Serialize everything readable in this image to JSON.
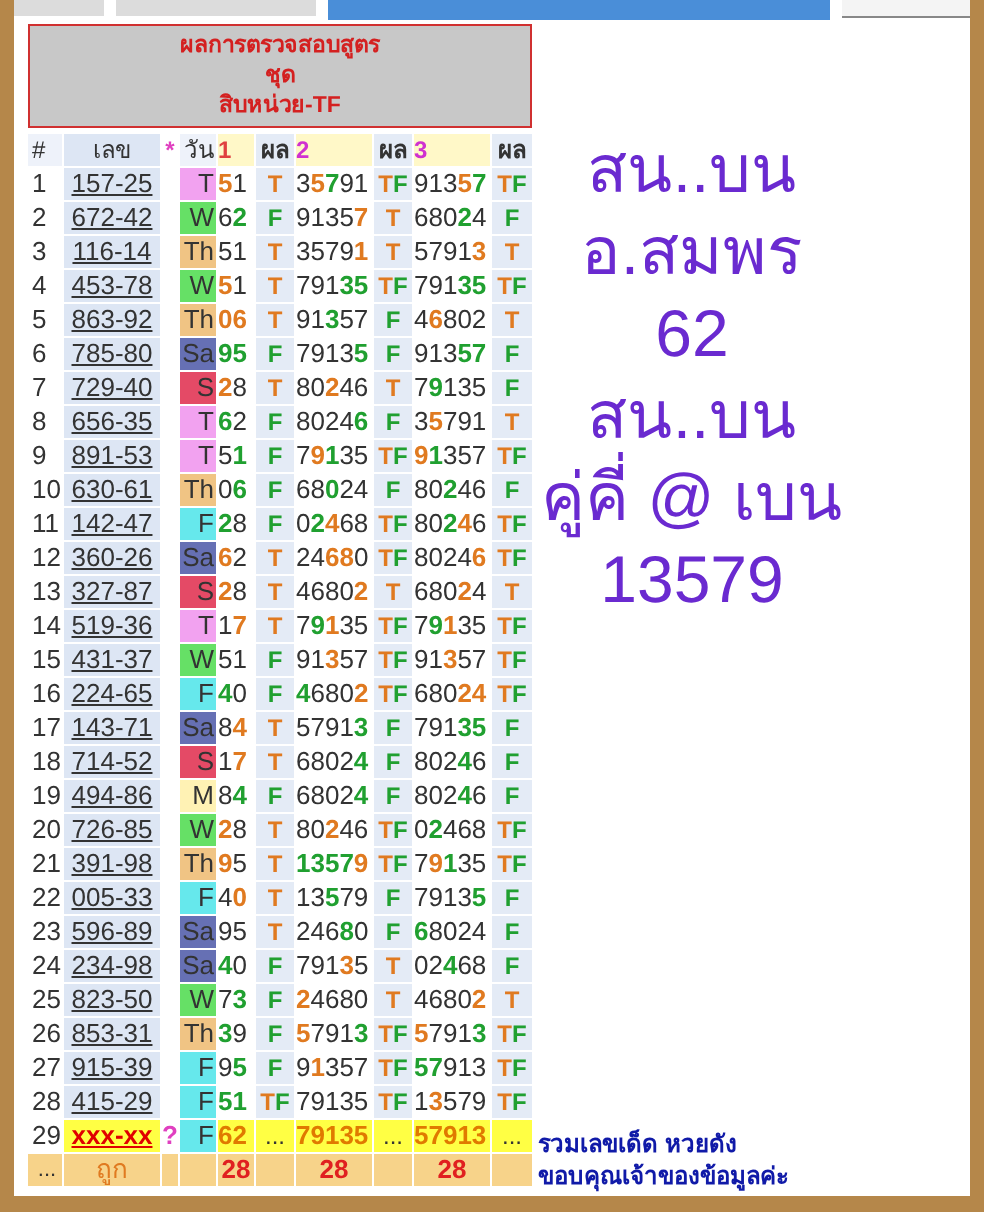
{
  "title_box": {
    "lines": [
      "ผลการตรวจสอบสูตร",
      "ชุด",
      "สิบหน่วย-TF"
    ]
  },
  "columns": [
    {
      "label": "#",
      "kind": "plain"
    },
    {
      "label": "เลข",
      "kind": "plain"
    },
    {
      "label": "*",
      "kind": "star"
    },
    {
      "label": "วัน",
      "kind": "plain"
    },
    {
      "label": "1",
      "kind": "pick1"
    },
    {
      "label": "ผล",
      "kind": "plain"
    },
    {
      "label": "2",
      "kind": "pick"
    },
    {
      "label": "ผล",
      "kind": "plain"
    },
    {
      "label": "3",
      "kind": "pick"
    },
    {
      "label": "ผล",
      "kind": "plain"
    }
  ],
  "rows": [
    {
      "kind": "result",
      "num": "1",
      "code": "157-25",
      "day": {
        "label": "T",
        "color": "#f2a2f0"
      },
      "cells": [
        {
          "parts": [
            {
              "text": "5",
              "color": "#e07a20"
            },
            {
              "text": "1"
            }
          ]
        },
        {
          "parts": [
            {
              "text": "T",
              "color": "#e07a20"
            }
          ]
        },
        {
          "parts": [
            {
              "text": "3"
            },
            {
              "text": "5",
              "color": "#e07a20"
            },
            {
              "text": "7",
              "color": "#20a030"
            },
            {
              "text": "91"
            }
          ]
        },
        {
          "parts": [
            {
              "text": "T",
              "color": "#e07a20"
            },
            {
              "text": "F",
              "color": "#20a030"
            }
          ]
        },
        {
          "parts": [
            {
              "text": "913"
            },
            {
              "text": "5",
              "color": "#e07a20"
            },
            {
              "text": "7",
              "color": "#20a030"
            }
          ]
        },
        {
          "parts": [
            {
              "text": "T",
              "color": "#e07a20"
            },
            {
              "text": "F",
              "color": "#20a030"
            }
          ]
        }
      ]
    },
    {
      "kind": "result",
      "num": "2",
      "code": "672-42",
      "day": {
        "label": "W",
        "color": "#66e066"
      },
      "cells": [
        {
          "parts": [
            {
              "text": "6"
            },
            {
              "text": "2",
              "color": "#20a030"
            }
          ]
        },
        {
          "parts": [
            {
              "text": "F",
              "color": "#20a030"
            }
          ]
        },
        {
          "parts": [
            {
              "text": "9135"
            },
            {
              "text": "7",
              "color": "#e07a20"
            }
          ]
        },
        {
          "parts": [
            {
              "text": "T",
              "color": "#e07a20"
            }
          ]
        },
        {
          "parts": [
            {
              "text": "680"
            },
            {
              "text": "2",
              "color": "#20a030"
            },
            {
              "text": "4"
            }
          ]
        },
        {
          "parts": [
            {
              "text": "F",
              "color": "#20a030"
            }
          ]
        }
      ]
    },
    {
      "kind": "result",
      "num": "3",
      "code": "116-14",
      "day": {
        "label": "Th",
        "color": "#f0c484"
      },
      "cells": [
        {
          "parts": [
            {
              "text": "51"
            }
          ]
        },
        {
          "parts": [
            {
              "text": "T",
              "color": "#e07a20"
            }
          ]
        },
        {
          "parts": [
            {
              "text": "3579"
            },
            {
              "text": "1",
              "color": "#e07a20"
            }
          ]
        },
        {
          "parts": [
            {
              "text": "T",
              "color": "#e07a20"
            }
          ]
        },
        {
          "parts": [
            {
              "text": "5791"
            },
            {
              "text": "3",
              "color": "#e07a20"
            }
          ]
        },
        {
          "parts": [
            {
              "text": "T",
              "color": "#e07a20"
            }
          ]
        }
      ]
    },
    {
      "kind": "result",
      "num": "4",
      "code": "453-78",
      "day": {
        "label": "W",
        "color": "#66e066"
      },
      "cells": [
        {
          "parts": [
            {
              "text": "5",
              "color": "#e07a20"
            },
            {
              "text": "1"
            }
          ]
        },
        {
          "parts": [
            {
              "text": "T",
              "color": "#e07a20"
            }
          ]
        },
        {
          "parts": [
            {
              "text": "791"
            },
            {
              "text": "35",
              "color": "#20a030"
            }
          ]
        },
        {
          "parts": [
            {
              "text": "T",
              "color": "#e07a20"
            },
            {
              "text": "F",
              "color": "#20a030"
            }
          ]
        },
        {
          "parts": [
            {
              "text": "791"
            },
            {
              "text": "35",
              "color": "#20a030"
            }
          ]
        },
        {
          "parts": [
            {
              "text": "T",
              "color": "#e07a20"
            },
            {
              "text": "F",
              "color": "#20a030"
            }
          ]
        }
      ]
    },
    {
      "kind": "result",
      "num": "5",
      "code": "863-92",
      "day": {
        "label": "Th",
        "color": "#f0c484"
      },
      "cells": [
        {
          "parts": [
            {
              "text": "06",
              "color": "#e07a20"
            }
          ]
        },
        {
          "parts": [
            {
              "text": "T",
              "color": "#e07a20"
            }
          ]
        },
        {
          "parts": [
            {
              "text": "91"
            },
            {
              "text": "3",
              "color": "#20a030"
            },
            {
              "text": "57"
            }
          ]
        },
        {
          "parts": [
            {
              "text": "F",
              "color": "#20a030"
            }
          ]
        },
        {
          "parts": [
            {
              "text": "4"
            },
            {
              "text": "6",
              "color": "#e07a20"
            },
            {
              "text": "802"
            }
          ]
        },
        {
          "parts": [
            {
              "text": "T",
              "color": "#e07a20"
            }
          ]
        }
      ]
    },
    {
      "kind": "result",
      "num": "6",
      "code": "785-80",
      "day": {
        "label": "Sa",
        "color": "#6670b4"
      },
      "cells": [
        {
          "parts": [
            {
              "text": "95",
              "color": "#20a030"
            }
          ]
        },
        {
          "parts": [
            {
              "text": "F",
              "color": "#20a030"
            }
          ]
        },
        {
          "parts": [
            {
              "text": "7913"
            },
            {
              "text": "5",
              "color": "#20a030"
            }
          ]
        },
        {
          "parts": [
            {
              "text": "F",
              "color": "#20a030"
            }
          ]
        },
        {
          "parts": [
            {
              "text": "913"
            },
            {
              "text": "57",
              "color": "#20a030"
            }
          ]
        },
        {
          "parts": [
            {
              "text": "F",
              "color": "#20a030"
            }
          ]
        }
      ]
    },
    {
      "kind": "result",
      "num": "7",
      "code": "729-40",
      "day": {
        "label": "S",
        "color": "#e44a66"
      },
      "cells": [
        {
          "parts": [
            {
              "text": "2",
              "color": "#e07a20"
            },
            {
              "text": "8"
            }
          ]
        },
        {
          "parts": [
            {
              "text": "T",
              "color": "#e07a20"
            }
          ]
        },
        {
          "parts": [
            {
              "text": "80"
            },
            {
              "text": "2",
              "color": "#e07a20"
            },
            {
              "text": "46"
            }
          ]
        },
        {
          "parts": [
            {
              "text": "T",
              "color": "#e07a20"
            }
          ]
        },
        {
          "parts": [
            {
              "text": "7"
            },
            {
              "text": "9",
              "color": "#20a030"
            },
            {
              "text": "135"
            }
          ]
        },
        {
          "parts": [
            {
              "text": "F",
              "color": "#20a030"
            }
          ]
        }
      ]
    },
    {
      "kind": "result",
      "num": "8",
      "code": "656-35",
      "day": {
        "label": "T",
        "color": "#f2a2f0"
      },
      "cells": [
        {
          "parts": [
            {
              "text": "6",
              "color": "#20a030"
            },
            {
              "text": "2"
            }
          ]
        },
        {
          "parts": [
            {
              "text": "F",
              "color": "#20a030"
            }
          ]
        },
        {
          "parts": [
            {
              "text": "8024"
            },
            {
              "text": "6",
              "color": "#20a030"
            }
          ]
        },
        {
          "parts": [
            {
              "text": "F",
              "color": "#20a030"
            }
          ]
        },
        {
          "parts": [
            {
              "text": "3"
            },
            {
              "text": "5",
              "color": "#e07a20"
            },
            {
              "text": "791"
            }
          ]
        },
        {
          "parts": [
            {
              "text": "T",
              "color": "#e07a20"
            }
          ]
        }
      ]
    },
    {
      "kind": "result",
      "num": "9",
      "code": "891-53",
      "day": {
        "label": "T",
        "color": "#f2a2f0"
      },
      "cells": [
        {
          "parts": [
            {
              "text": "5"
            },
            {
              "text": "1",
              "color": "#20a030"
            }
          ]
        },
        {
          "parts": [
            {
              "text": "F",
              "color": "#20a030"
            }
          ]
        },
        {
          "parts": [
            {
              "text": "7"
            },
            {
              "text": "9",
              "color": "#e07a20"
            },
            {
              "text": "1",
              "color": "#20a030"
            },
            {
              "text": "35"
            }
          ]
        },
        {
          "parts": [
            {
              "text": "T",
              "color": "#e07a20"
            },
            {
              "text": "F",
              "color": "#20a030"
            }
          ]
        },
        {
          "parts": [
            {
              "text": "9",
              "color": "#e07a20"
            },
            {
              "text": "1",
              "color": "#20a030"
            },
            {
              "text": "357"
            }
          ]
        },
        {
          "parts": [
            {
              "text": "T",
              "color": "#e07a20"
            },
            {
              "text": "F",
              "color": "#20a030"
            }
          ]
        }
      ]
    },
    {
      "kind": "result",
      "num": "10",
      "code": "630-61",
      "day": {
        "label": "Th",
        "color": "#f0c484"
      },
      "cells": [
        {
          "parts": [
            {
              "text": "0"
            },
            {
              "text": "6",
              "color": "#20a030"
            }
          ]
        },
        {
          "parts": [
            {
              "text": "F",
              "color": "#20a030"
            }
          ]
        },
        {
          "parts": [
            {
              "text": "68"
            },
            {
              "text": "0",
              "color": "#20a030"
            },
            {
              "text": "24"
            }
          ]
        },
        {
          "parts": [
            {
              "text": "F",
              "color": "#20a030"
            }
          ]
        },
        {
          "parts": [
            {
              "text": "80"
            },
            {
              "text": "2",
              "color": "#20a030"
            },
            {
              "text": "46"
            }
          ]
        },
        {
          "parts": [
            {
              "text": "F",
              "color": "#20a030"
            }
          ]
        }
      ]
    },
    {
      "kind": "result",
      "num": "11",
      "code": "142-47",
      "day": {
        "label": "F",
        "color": "#66e8ec"
      },
      "cells": [
        {
          "parts": [
            {
              "text": "2",
              "color": "#20a030"
            },
            {
              "text": "8"
            }
          ]
        },
        {
          "parts": [
            {
              "text": "F",
              "color": "#20a030"
            }
          ]
        },
        {
          "parts": [
            {
              "text": "0"
            },
            {
              "text": "2",
              "color": "#20a030"
            },
            {
              "text": "4",
              "color": "#e07a20"
            },
            {
              "text": "68"
            }
          ]
        },
        {
          "parts": [
            {
              "text": "T",
              "color": "#e07a20"
            },
            {
              "text": "F",
              "color": "#20a030"
            }
          ]
        },
        {
          "parts": [
            {
              "text": "80"
            },
            {
              "text": "2",
              "color": "#20a030"
            },
            {
              "text": "4",
              "color": "#e07a20"
            },
            {
              "text": "6"
            }
          ]
        },
        {
          "parts": [
            {
              "text": "T",
              "color": "#e07a20"
            },
            {
              "text": "F",
              "color": "#20a030"
            }
          ]
        }
      ]
    },
    {
      "kind": "result",
      "num": "12",
      "code": "360-26",
      "day": {
        "label": "Sa",
        "color": "#6670b4"
      },
      "cells": [
        {
          "parts": [
            {
              "text": "6",
              "color": "#e07a20"
            },
            {
              "text": "2"
            }
          ]
        },
        {
          "parts": [
            {
              "text": "T",
              "color": "#e07a20"
            }
          ]
        },
        {
          "parts": [
            {
              "text": "24"
            },
            {
              "text": "68",
              "color": "#e07a20"
            },
            {
              "text": "0"
            }
          ]
        },
        {
          "parts": [
            {
              "text": "T",
              "color": "#e07a20"
            },
            {
              "text": "F",
              "color": "#20a030"
            }
          ]
        },
        {
          "parts": [
            {
              "text": "8024"
            },
            {
              "text": "6",
              "color": "#e07a20"
            }
          ]
        },
        {
          "parts": [
            {
              "text": "T",
              "color": "#e07a20"
            },
            {
              "text": "F",
              "color": "#20a030"
            }
          ]
        }
      ]
    },
    {
      "kind": "result",
      "num": "13",
      "code": "327-87",
      "day": {
        "label": "S",
        "color": "#e44a66"
      },
      "cells": [
        {
          "parts": [
            {
              "text": "2",
              "color": "#e07a20"
            },
            {
              "text": "8"
            }
          ]
        },
        {
          "parts": [
            {
              "text": "T",
              "color": "#e07a20"
            }
          ]
        },
        {
          "parts": [
            {
              "text": "4680"
            },
            {
              "text": "2",
              "color": "#e07a20"
            }
          ]
        },
        {
          "parts": [
            {
              "text": "T",
              "color": "#e07a20"
            }
          ]
        },
        {
          "parts": [
            {
              "text": "680"
            },
            {
              "text": "2",
              "color": "#e07a20"
            },
            {
              "text": "4"
            }
          ]
        },
        {
          "parts": [
            {
              "text": "T",
              "color": "#e07a20"
            }
          ]
        }
      ]
    },
    {
      "kind": "result",
      "num": "14",
      "code": "519-36",
      "day": {
        "label": "T",
        "color": "#f2a2f0"
      },
      "cells": [
        {
          "parts": [
            {
              "text": "1"
            },
            {
              "text": "7",
              "color": "#e07a20"
            }
          ]
        },
        {
          "parts": [
            {
              "text": "T",
              "color": "#e07a20"
            }
          ]
        },
        {
          "parts": [
            {
              "text": "7"
            },
            {
              "text": "9",
              "color": "#20a030"
            },
            {
              "text": "1",
              "color": "#e07a20"
            },
            {
              "text": "35"
            }
          ]
        },
        {
          "parts": [
            {
              "text": "T",
              "color": "#e07a20"
            },
            {
              "text": "F",
              "color": "#20a030"
            }
          ]
        },
        {
          "parts": [
            {
              "text": "7"
            },
            {
              "text": "9",
              "color": "#20a030"
            },
            {
              "text": "1",
              "color": "#e07a20"
            },
            {
              "text": "35"
            }
          ]
        },
        {
          "parts": [
            {
              "text": "T",
              "color": "#e07a20"
            },
            {
              "text": "F",
              "color": "#20a030"
            }
          ]
        }
      ]
    },
    {
      "kind": "result",
      "num": "15",
      "code": "431-37",
      "day": {
        "label": "W",
        "color": "#66e066"
      },
      "cells": [
        {
          "parts": [
            {
              "text": "51"
            }
          ]
        },
        {
          "parts": [
            {
              "text": "F",
              "color": "#20a030"
            }
          ]
        },
        {
          "parts": [
            {
              "text": "91"
            },
            {
              "text": "3",
              "color": "#e07a20"
            },
            {
              "text": "57"
            }
          ]
        },
        {
          "parts": [
            {
              "text": "T",
              "color": "#e07a20"
            },
            {
              "text": "F",
              "color": "#20a030"
            }
          ]
        },
        {
          "parts": [
            {
              "text": "91"
            },
            {
              "text": "3",
              "color": "#e07a20"
            },
            {
              "text": "57"
            }
          ]
        },
        {
          "parts": [
            {
              "text": "T",
              "color": "#e07a20"
            },
            {
              "text": "F",
              "color": "#20a030"
            }
          ]
        }
      ]
    },
    {
      "kind": "result",
      "num": "16",
      "code": "224-65",
      "day": {
        "label": "F",
        "color": "#66e8ec"
      },
      "cells": [
        {
          "parts": [
            {
              "text": "4",
              "color": "#20a030"
            },
            {
              "text": "0"
            }
          ]
        },
        {
          "parts": [
            {
              "text": "F",
              "color": "#20a030"
            }
          ]
        },
        {
          "parts": [
            {
              "text": "4",
              "color": "#20a030"
            },
            {
              "text": "680"
            },
            {
              "text": "2",
              "color": "#e07a20"
            }
          ]
        },
        {
          "parts": [
            {
              "text": "T",
              "color": "#e07a20"
            },
            {
              "text": "F",
              "color": "#20a030"
            }
          ]
        },
        {
          "parts": [
            {
              "text": "680"
            },
            {
              "text": "24",
              "color": "#e07a20"
            }
          ]
        },
        {
          "parts": [
            {
              "text": "T",
              "color": "#e07a20"
            },
            {
              "text": "F",
              "color": "#20a030"
            }
          ]
        }
      ]
    },
    {
      "kind": "result",
      "num": "17",
      "code": "143-71",
      "day": {
        "label": "Sa",
        "color": "#6670b4"
      },
      "cells": [
        {
          "parts": [
            {
              "text": "8"
            },
            {
              "text": "4",
              "color": "#e07a20"
            }
          ]
        },
        {
          "parts": [
            {
              "text": "T",
              "color": "#e07a20"
            }
          ]
        },
        {
          "parts": [
            {
              "text": "5791"
            },
            {
              "text": "3",
              "color": "#20a030"
            }
          ]
        },
        {
          "parts": [
            {
              "text": "F",
              "color": "#20a030"
            }
          ]
        },
        {
          "parts": [
            {
              "text": "791"
            },
            {
              "text": "35",
              "color": "#20a030"
            }
          ]
        },
        {
          "parts": [
            {
              "text": "F",
              "color": "#20a030"
            }
          ]
        }
      ]
    },
    {
      "kind": "result",
      "num": "18",
      "code": "714-52",
      "day": {
        "label": "S",
        "color": "#e44a66"
      },
      "cells": [
        {
          "parts": [
            {
              "text": "1"
            },
            {
              "text": "7",
              "color": "#e07a20"
            }
          ]
        },
        {
          "parts": [
            {
              "text": "T",
              "color": "#e07a20"
            }
          ]
        },
        {
          "parts": [
            {
              "text": "6802"
            },
            {
              "text": "4",
              "color": "#20a030"
            }
          ]
        },
        {
          "parts": [
            {
              "text": "F",
              "color": "#20a030"
            }
          ]
        },
        {
          "parts": [
            {
              "text": "802"
            },
            {
              "text": "4",
              "color": "#20a030"
            },
            {
              "text": "6"
            }
          ]
        },
        {
          "parts": [
            {
              "text": "F",
              "color": "#20a030"
            }
          ]
        }
      ]
    },
    {
      "kind": "result",
      "num": "19",
      "code": "494-86",
      "day": {
        "label": "M",
        "color": "#fff2b4"
      },
      "cells": [
        {
          "parts": [
            {
              "text": "8"
            },
            {
              "text": "4",
              "color": "#20a030"
            }
          ]
        },
        {
          "parts": [
            {
              "text": "F",
              "color": "#20a030"
            }
          ]
        },
        {
          "parts": [
            {
              "text": "6802"
            },
            {
              "text": "4",
              "color": "#20a030"
            }
          ]
        },
        {
          "parts": [
            {
              "text": "F",
              "color": "#20a030"
            }
          ]
        },
        {
          "parts": [
            {
              "text": "802"
            },
            {
              "text": "4",
              "color": "#20a030"
            },
            {
              "text": "6"
            }
          ]
        },
        {
          "parts": [
            {
              "text": "F",
              "color": "#20a030"
            }
          ]
        }
      ]
    },
    {
      "kind": "result",
      "num": "20",
      "code": "726-85",
      "day": {
        "label": "W",
        "color": "#66e066"
      },
      "cells": [
        {
          "parts": [
            {
              "text": "2",
              "color": "#e07a20"
            },
            {
              "text": "8"
            }
          ]
        },
        {
          "parts": [
            {
              "text": "T",
              "color": "#e07a20"
            }
          ]
        },
        {
          "parts": [
            {
              "text": "80"
            },
            {
              "text": "2",
              "color": "#e07a20"
            },
            {
              "text": "46"
            }
          ]
        },
        {
          "parts": [
            {
              "text": "T",
              "color": "#e07a20"
            },
            {
              "text": "F",
              "color": "#20a030"
            }
          ]
        },
        {
          "parts": [
            {
              "text": "0"
            },
            {
              "text": "2",
              "color": "#20a030"
            },
            {
              "text": "468"
            }
          ]
        },
        {
          "parts": [
            {
              "text": "T",
              "color": "#e07a20"
            },
            {
              "text": "F",
              "color": "#20a030"
            }
          ]
        }
      ]
    },
    {
      "kind": "result",
      "num": "21",
      "code": "391-98",
      "day": {
        "label": "Th",
        "color": "#f0c484"
      },
      "cells": [
        {
          "parts": [
            {
              "text": "9",
              "color": "#e07a20"
            },
            {
              "text": "5"
            }
          ]
        },
        {
          "parts": [
            {
              "text": "T",
              "color": "#e07a20"
            }
          ]
        },
        {
          "parts": [
            {
              "text": "1357",
              "color": "#20a030"
            },
            {
              "text": "9",
              "color": "#e07a20"
            }
          ]
        },
        {
          "parts": [
            {
              "text": "T",
              "color": "#e07a20"
            },
            {
              "text": "F",
              "color": "#20a030"
            }
          ]
        },
        {
          "parts": [
            {
              "text": "7"
            },
            {
              "text": "9",
              "color": "#e07a20"
            },
            {
              "text": "1",
              "color": "#20a030"
            },
            {
              "text": "35"
            }
          ]
        },
        {
          "parts": [
            {
              "text": "T",
              "color": "#e07a20"
            },
            {
              "text": "F",
              "color": "#20a030"
            }
          ]
        }
      ]
    },
    {
      "kind": "result",
      "num": "22",
      "code": "005-33",
      "day": {
        "label": "F",
        "color": "#66e8ec"
      },
      "cells": [
        {
          "parts": [
            {
              "text": "4"
            },
            {
              "text": "0",
              "color": "#e07a20"
            }
          ]
        },
        {
          "parts": [
            {
              "text": "T",
              "color": "#e07a20"
            }
          ]
        },
        {
          "parts": [
            {
              "text": "13"
            },
            {
              "text": "5",
              "color": "#20a030"
            },
            {
              "text": "79"
            }
          ]
        },
        {
          "parts": [
            {
              "text": "F",
              "color": "#20a030"
            }
          ]
        },
        {
          "parts": [
            {
              "text": "7913"
            },
            {
              "text": "5",
              "color": "#20a030"
            }
          ]
        },
        {
          "parts": [
            {
              "text": "F",
              "color": "#20a030"
            }
          ]
        }
      ]
    },
    {
      "kind": "result",
      "num": "23",
      "code": "596-89",
      "day": {
        "label": "Sa",
        "color": "#6670b4"
      },
      "cells": [
        {
          "parts": [
            {
              "text": "95"
            }
          ]
        },
        {
          "parts": [
            {
              "text": "T",
              "color": "#e07a20"
            }
          ]
        },
        {
          "parts": [
            {
              "text": "246"
            },
            {
              "text": "8",
              "color": "#20a030"
            },
            {
              "text": "0"
            }
          ]
        },
        {
          "parts": [
            {
              "text": "F",
              "color": "#20a030"
            }
          ]
        },
        {
          "parts": [
            {
              "text": "6",
              "color": "#20a030"
            },
            {
              "text": "8024"
            }
          ]
        },
        {
          "parts": [
            {
              "text": "F",
              "color": "#20a030"
            }
          ]
        }
      ]
    },
    {
      "kind": "result",
      "num": "24",
      "code": "234-98",
      "day": {
        "label": "Sa",
        "color": "#6670b4"
      },
      "cells": [
        {
          "parts": [
            {
              "text": "4",
              "color": "#20a030"
            },
            {
              "text": "0"
            }
          ]
        },
        {
          "parts": [
            {
              "text": "F",
              "color": "#20a030"
            }
          ]
        },
        {
          "parts": [
            {
              "text": "791"
            },
            {
              "text": "3",
              "color": "#e07a20"
            },
            {
              "text": "5"
            }
          ]
        },
        {
          "parts": [
            {
              "text": "T",
              "color": "#e07a20"
            }
          ]
        },
        {
          "parts": [
            {
              "text": "02"
            },
            {
              "text": "4",
              "color": "#20a030"
            },
            {
              "text": "68"
            }
          ]
        },
        {
          "parts": [
            {
              "text": "F",
              "color": "#20a030"
            }
          ]
        }
      ]
    },
    {
      "kind": "result",
      "num": "25",
      "code": "823-50",
      "day": {
        "label": "W",
        "color": "#66e066"
      },
      "cells": [
        {
          "parts": [
            {
              "text": "7"
            },
            {
              "text": "3",
              "color": "#20a030"
            }
          ]
        },
        {
          "parts": [
            {
              "text": "F",
              "color": "#20a030"
            }
          ]
        },
        {
          "parts": [
            {
              "text": "2",
              "color": "#e07a20"
            },
            {
              "text": "4680"
            }
          ]
        },
        {
          "parts": [
            {
              "text": "T",
              "color": "#e07a20"
            }
          ]
        },
        {
          "parts": [
            {
              "text": "4680"
            },
            {
              "text": "2",
              "color": "#e07a20"
            }
          ]
        },
        {
          "parts": [
            {
              "text": "T",
              "color": "#e07a20"
            }
          ]
        }
      ]
    },
    {
      "kind": "result",
      "num": "26",
      "code": "853-31",
      "day": {
        "label": "Th",
        "color": "#f0c484"
      },
      "cells": [
        {
          "parts": [
            {
              "text": "3",
              "color": "#20a030"
            },
            {
              "text": "9"
            }
          ]
        },
        {
          "parts": [
            {
              "text": "F",
              "color": "#20a030"
            }
          ]
        },
        {
          "parts": [
            {
              "text": "5",
              "color": "#e07a20"
            },
            {
              "text": "791"
            },
            {
              "text": "3",
              "color": "#20a030"
            }
          ]
        },
        {
          "parts": [
            {
              "text": "T",
              "color": "#e07a20"
            },
            {
              "text": "F",
              "color": "#20a030"
            }
          ]
        },
        {
          "parts": [
            {
              "text": "5",
              "color": "#e07a20"
            },
            {
              "text": "791"
            },
            {
              "text": "3",
              "color": "#20a030"
            }
          ]
        },
        {
          "parts": [
            {
              "text": "T",
              "color": "#e07a20"
            },
            {
              "text": "F",
              "color": "#20a030"
            }
          ]
        }
      ]
    },
    {
      "kind": "result",
      "num": "27",
      "code": "915-39",
      "day": {
        "label": "F",
        "color": "#66e8ec"
      },
      "cells": [
        {
          "parts": [
            {
              "text": "9"
            },
            {
              "text": "5",
              "color": "#20a030"
            }
          ]
        },
        {
          "parts": [
            {
              "text": "F",
              "color": "#20a030"
            }
          ]
        },
        {
          "parts": [
            {
              "text": "9"
            },
            {
              "text": "1",
              "color": "#e07a20"
            },
            {
              "text": "357"
            }
          ]
        },
        {
          "parts": [
            {
              "text": "T",
              "color": "#e07a20"
            },
            {
              "text": "F",
              "color": "#20a030"
            }
          ]
        },
        {
          "parts": [
            {
              "text": "57",
              "color": "#20a030"
            },
            {
              "text": "913"
            }
          ]
        },
        {
          "parts": [
            {
              "text": "T",
              "color": "#e07a20"
            },
            {
              "text": "F",
              "color": "#20a030"
            }
          ]
        }
      ]
    },
    {
      "kind": "result",
      "num": "28",
      "code": "415-29",
      "day": {
        "label": "F",
        "color": "#66e8ec"
      },
      "cells": [
        {
          "parts": [
            {
              "text": "51",
              "color": "#20a030"
            }
          ]
        },
        {
          "parts": [
            {
              "text": "T",
              "color": "#e07a20"
            },
            {
              "text": "F",
              "color": "#20a030"
            }
          ]
        },
        {
          "parts": [
            {
              "text": "79135"
            }
          ]
        },
        {
          "parts": [
            {
              "text": "T",
              "color": "#e07a20"
            },
            {
              "text": "F",
              "color": "#20a030"
            }
          ]
        },
        {
          "parts": [
            {
              "text": "1"
            },
            {
              "text": "3",
              "color": "#e07a20"
            },
            {
              "text": "579"
            }
          ]
        },
        {
          "parts": [
            {
              "text": "T",
              "color": "#e07a20"
            },
            {
              "text": "F",
              "color": "#20a030"
            }
          ]
        }
      ]
    },
    {
      "kind": "pending",
      "num": "29",
      "code": "xxx-xx",
      "star": "?",
      "day": {
        "label": "F",
        "color": "#66e8ec"
      },
      "cells": [
        {
          "text": "62"
        },
        {
          "text": "..."
        },
        {
          "text": "79135"
        },
        {
          "text": "..."
        },
        {
          "text": "57913"
        },
        {
          "text": "..."
        }
      ]
    },
    {
      "kind": "total",
      "num": "...",
      "code": "ถูก",
      "cells": [
        {
          "text": "28"
        },
        {},
        {
          "text": "28"
        },
        {},
        {
          "text": "28"
        },
        {}
      ]
    }
  ],
  "big_text": [
    "สน..บน",
    "อ.สมพร",
    "62",
    "สน..บน",
    "คู่คี่ @ เบน",
    "13579"
  ],
  "footer_lines": [
    "รวมเลขเด็ด หวยดัง",
    "ขอบคุณเจ้าของข้อมูลค่ะ"
  ]
}
